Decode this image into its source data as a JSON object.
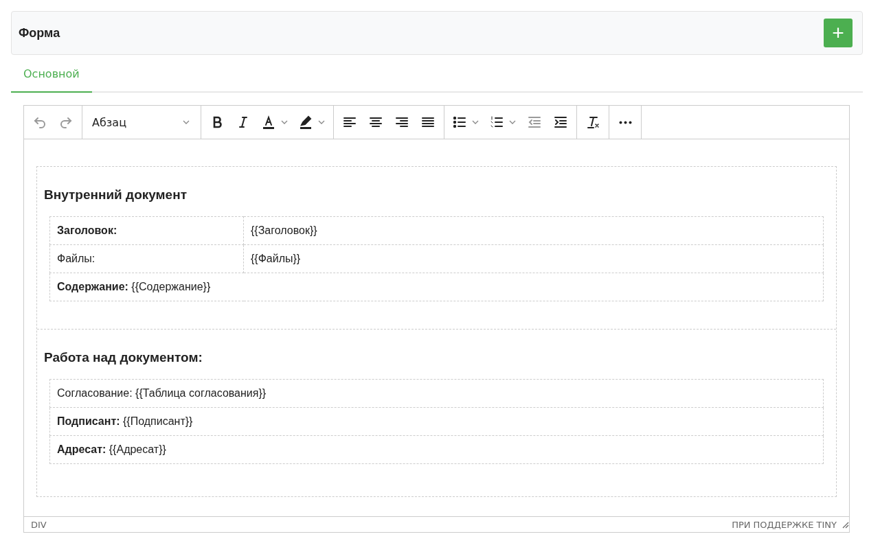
{
  "header": {
    "title": "Форма",
    "add_button": "+"
  },
  "tabs": [
    {
      "label": "Основной",
      "selected": true
    }
  ],
  "toolbar": [
    [
      {
        "kind": "undo",
        "disabled": true
      },
      {
        "kind": "redo",
        "disabled": true
      }
    ],
    [
      {
        "kind": "select",
        "label": "Абзац",
        "disabled": false
      }
    ],
    [
      {
        "kind": "bold",
        "disabled": false
      },
      {
        "kind": "italic",
        "disabled": false
      },
      {
        "kind": "text-color",
        "split": true,
        "disabled": false
      },
      {
        "kind": "highlight",
        "split": true,
        "disabled": false
      }
    ],
    [
      {
        "kind": "align-left",
        "disabled": false
      },
      {
        "kind": "align-center",
        "disabled": false
      },
      {
        "kind": "align-right",
        "disabled": false
      },
      {
        "kind": "justify",
        "disabled": false
      }
    ],
    [
      {
        "kind": "bullet-list",
        "split": true,
        "disabled": false
      },
      {
        "kind": "numbered-list",
        "split": true,
        "disabled": false
      },
      {
        "kind": "outdent",
        "disabled": true
      },
      {
        "kind": "indent",
        "disabled": false
      }
    ],
    [
      {
        "kind": "clear-format",
        "disabled": false
      }
    ],
    [
      {
        "kind": "more",
        "disabled": false
      }
    ]
  ],
  "document": [
    {
      "heading": "Внутренний документ",
      "rows": [
        {
          "cells": [
            {
              "text": "Заголовок:",
              "bold": true
            },
            {
              "text": "{{Заголовок}}",
              "bold": false
            }
          ]
        },
        {
          "cells": [
            {
              "text": "Файлы:",
              "bold": false
            },
            {
              "text": "{{Файлы}}",
              "bold": false
            }
          ]
        },
        {
          "cells": [
            {
              "text": "**Содержание:** {{Содержание}}",
              "bold": false,
              "colspan": 2
            }
          ]
        }
      ]
    },
    {
      "heading": "Работа над документом:",
      "rows": [
        {
          "cells": [
            {
              "text": "Согласование: {{Таблица согласования}}",
              "bold": false
            }
          ]
        },
        {
          "cells": [
            {
              "text": "**Подписант:** {{Подписант}}",
              "bold": false
            }
          ]
        },
        {
          "cells": [
            {
              "text": "**Адресат:** {{Адресат}}",
              "bold": false
            }
          ]
        }
      ]
    }
  ],
  "status_bar": {
    "path": "DIV",
    "branding": "ПРИ ПОДДЕРЖКЕ TINY"
  }
}
